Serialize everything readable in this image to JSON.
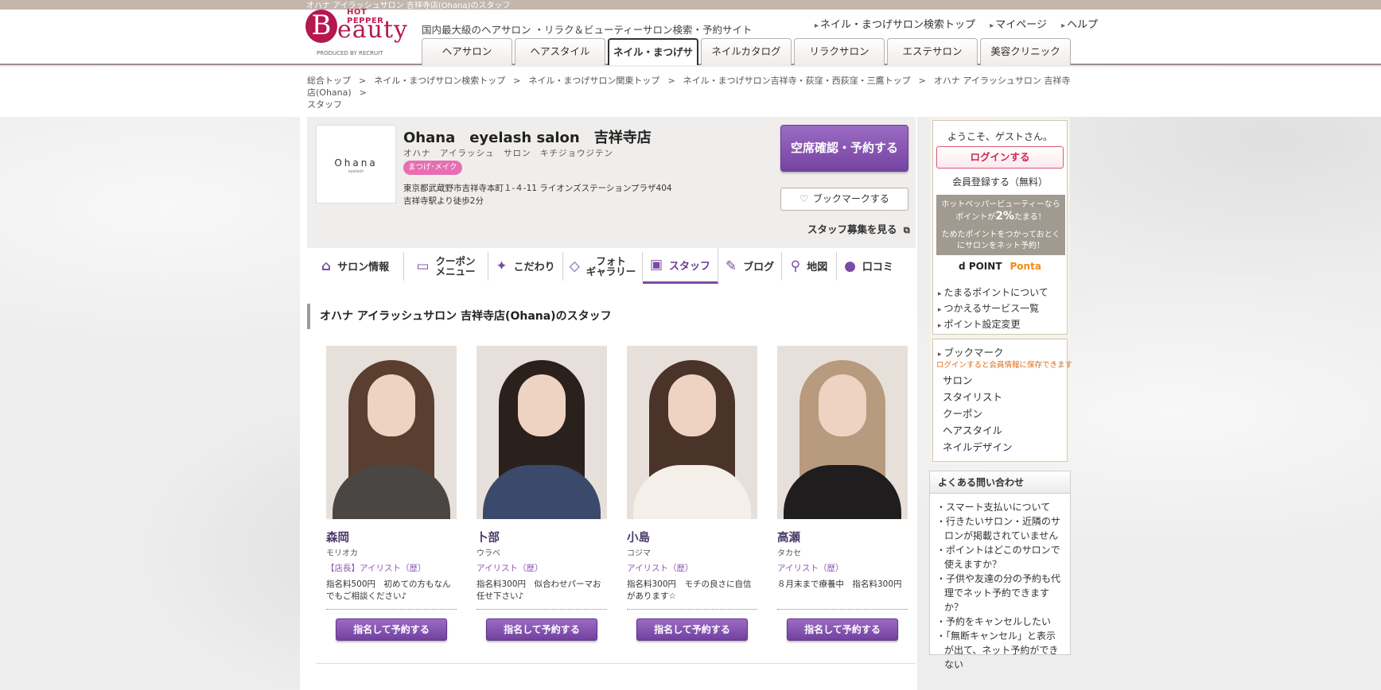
{
  "window_title": "オハナ アイラッシュサロン 吉祥寺店(Ohana)のスタッフ",
  "header": {
    "logo_hp": "HOT PEPPER",
    "logo_b": "B",
    "logo_eauty": "eauty",
    "logo_produced": "PRODUCED BY RECRUIT",
    "tagline": "国内最大級のヘアサロン ・リラク＆ビューティーサロン検索・予約サイト",
    "links": [
      "ネイル・まつげサロン検索トップ",
      "マイページ",
      "ヘルプ"
    ],
    "tabs": [
      "ヘアサロン",
      "ヘアスタイル",
      "ネイル・まつげサロン",
      "ネイルカタログ",
      "リラクサロン",
      "エステサロン",
      "美容クリニック"
    ]
  },
  "breadcrumb": [
    "総合トップ",
    "ネイル・まつげサロン検索トップ",
    "ネイル・まつげサロン関東トップ",
    "ネイル・まつげサロン吉祥寺・荻窪・西荻窪・三鷹トップ",
    "オハナ アイラッシュサロン 吉祥寺店(Ohana)",
    "スタッフ"
  ],
  "salon": {
    "logo_text": "Ohana",
    "logo_sub": "eyelash",
    "name": "Ohana　eyelash salon　吉祥寺店",
    "kana": "オハナ　アイラッシュ　サロン　キチジョウジテン",
    "badge": "まつげ･メイク",
    "address": "東京都武蔵野市吉祥寺本町１-４-11 ライオンズステーションプラザ404",
    "access": "吉祥寺駅より徒歩2分",
    "reserve_label": "空席確認・予約する",
    "bookmark_label": "ブックマークする",
    "recruit_label": "スタッフ募集を見る"
  },
  "subnav": [
    {
      "icon": "house-icon",
      "label": "サロン情報"
    },
    {
      "icon": "coupon-icon",
      "label": "クーポン\nメニュー"
    },
    {
      "icon": "sparkle-icon",
      "label": "こだわり"
    },
    {
      "icon": "photo-icon",
      "label": "フォト\nギャラリー"
    },
    {
      "icon": "staff-card-icon",
      "label": "スタッフ"
    },
    {
      "icon": "pen-icon",
      "label": "ブログ"
    },
    {
      "icon": "map-pin-icon",
      "label": "地図"
    },
    {
      "icon": "speech-bubble-icon",
      "label": "口コミ"
    }
  ],
  "section_title": "オハナ アイラッシュサロン 吉祥寺店(Ohana)のスタッフ",
  "staff": [
    {
      "name": "森岡",
      "kana": "モリオカ",
      "role": "【店長】アイリスト（歴）",
      "comment": "指名料500円　初めての方もなんでもご相談ください♪",
      "button": "指名して予約する",
      "hair": "#5a3f30",
      "clothes": "#4a4644"
    },
    {
      "name": "卜部",
      "kana": "ウラベ",
      "role": "アイリスト（歴）",
      "comment": "指名料300円　似合わせパーマお任せ下さい♪",
      "button": "指名して予約する",
      "hair": "#2a211d",
      "clothes": "#3b4a6b"
    },
    {
      "name": "小島",
      "kana": "コジマ",
      "role": "アイリスト（歴）",
      "comment": "指名料300円　モチの良さに自信があります☆",
      "button": "指名して予約する",
      "hair": "#4a342a",
      "clothes": "#f4efe8"
    },
    {
      "name": "高瀬",
      "kana": "タカセ",
      "role": "アイリスト（歴）",
      "comment": "８月末まで療養中　指名料300円",
      "button": "指名して予約する",
      "hair": "#b89a7e",
      "clothes": "#1f1d1d"
    }
  ],
  "sidebar": {
    "welcome": "ようこそ、ゲストさん。",
    "login": "ログインする",
    "register": "会員登録する（無料）",
    "point_line1": "ホットペッパービューティーなら",
    "point_pre": "ポイントが",
    "point_rate": "2%",
    "point_post": "たまる！",
    "point_line3": "ためたポイントをつかっておとく",
    "point_line4": "にサロンをネット予約！",
    "dpoint": "d POINT",
    "ponta": "Ponta",
    "point_links": [
      "たまるポイントについて",
      "つかえるサービス一覧",
      "ポイント設定変更"
    ],
    "bookmark_title": "ブックマーク",
    "bookmark_note": "ログインすると会員情報に保存できます",
    "bookmark_items": [
      "サロン",
      "スタイリスト",
      "クーポン",
      "ヘアスタイル",
      "ネイルデザイン"
    ],
    "faq_title": "よくある問い合わせ",
    "faq_items": [
      "スマート支払いについて",
      "行きたいサロン・近隣のサロンが掲載されていません",
      "ポイントはどこのサロンで使えますか？",
      "子供や友達の分の予約も代理でネット予約できますか？",
      "予約をキャンセルしたい",
      "「無断キャンセル」と表示が出て、ネット予約ができない"
    ]
  }
}
